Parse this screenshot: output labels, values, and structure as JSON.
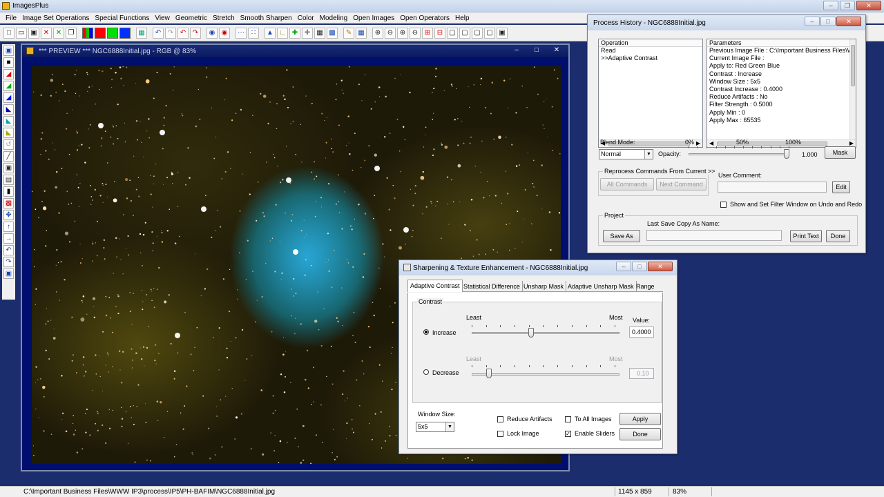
{
  "app": {
    "title": "ImagesPlus"
  },
  "menu": [
    "File",
    "Image Set Operations",
    "Special Functions",
    "View",
    "Geometric",
    "Stretch",
    "Smooth Sharpen",
    "Color",
    "Modeling",
    "Open Images",
    "Open Operators",
    "Help"
  ],
  "colors": {
    "swatch_red": "#ff0000",
    "swatch_green": "#00e000",
    "swatch_blue": "#0030ff",
    "accent": "#0b1a5e"
  },
  "preview": {
    "title": "*** PREVIEW *** NGC6888Initial.jpg - RGB @ 83%"
  },
  "status": {
    "path": "C:\\Important Business Files\\WWW IP3\\process\\IP5\\PH-BAFIM\\NGC6888Initial.jpg",
    "dimensions": "1145 x 859",
    "zoom": "83%"
  },
  "history": {
    "title": "Process History - NGC6888Initial.jpg",
    "operation_header": "Operation",
    "parameters_header": "Parameters",
    "operations": [
      "Read",
      ">>Adaptive Contrast"
    ],
    "parameters": [
      "Previous Image File : C:\\Important Business Files\\W\\",
      "Current Image File :",
      "Apply to:  Red Green Blue",
      "Contrast : Increase",
      "Window Size : 5x5",
      "Contrast Increase : 0.4000",
      "Reduce Artifacts : No",
      "Filter Strength : 0.5000",
      "Apply Min : 0",
      "Apply Max : 65535"
    ],
    "blend_mode_label": "Blend Mode:",
    "blend_mode_value": "Normal",
    "pct_0": "0%",
    "pct_50": "50%",
    "pct_100": "100%",
    "opacity_label": "Opacity:",
    "opacity_value": "1.000",
    "opacity_level": 1.0,
    "mask_button": "Mask",
    "reprocess_label": "Reprocess Commands From Current >>",
    "all_commands": "All Commands",
    "next_command": "Next Command",
    "user_comment_label": "User Comment:",
    "edit_button": "Edit",
    "show_filter_label": "Show and Set Filter Window on Undo and Redo",
    "project_label": "Project",
    "last_save_label": "Last Save Copy As Name:",
    "save_as": "Save As",
    "print_text": "Print Text",
    "done": "Done"
  },
  "sharpen": {
    "title": "Sharpening & Texture Enhancement - NGC6888Initial.jpg",
    "tabs": [
      "Adaptive Contrast",
      "Statistical Difference",
      "Unsharp Mask",
      "Adaptive Unsharp Mask",
      "Range"
    ],
    "contrast_group": "Contrast",
    "least": "Least",
    "most": "Most",
    "value_label": "Value:",
    "increase_label": "Increase",
    "increase_value": "0.4000",
    "increase_level": 0.4,
    "decrease_label": "Decrease",
    "decrease_value": "0.10",
    "decrease_level": 0.1,
    "window_size_label": "Window Size:",
    "window_size_value": "5x5",
    "reduce_artifacts": "Reduce Artifacts",
    "lock_image": "Lock Image",
    "to_all_images": "To All Images",
    "enable_sliders": "Enable Sliders",
    "apply": "Apply",
    "done": "Done"
  }
}
